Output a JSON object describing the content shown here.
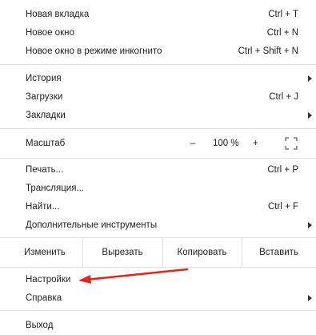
{
  "menu": {
    "new_tab": {
      "label": "Новая вкладка",
      "shortcut": "Ctrl + T"
    },
    "new_window": {
      "label": "Новое окно",
      "shortcut": "Ctrl + N"
    },
    "incognito": {
      "label": "Новое окно в режиме инкогнито",
      "shortcut": "Ctrl + Shift + N"
    },
    "history": {
      "label": "История"
    },
    "downloads": {
      "label": "Загрузки",
      "shortcut": "Ctrl + J"
    },
    "bookmarks": {
      "label": "Закладки"
    },
    "zoom": {
      "label": "Масштаб",
      "minus": "–",
      "value": "100 %",
      "plus": "+",
      "fullscreen_icon": "fullscreen-icon"
    },
    "print": {
      "label": "Печать...",
      "shortcut": "Ctrl + P"
    },
    "cast": {
      "label": "Трансляция..."
    },
    "find": {
      "label": "Найти...",
      "shortcut": "Ctrl + F"
    },
    "more_tools": {
      "label": "Дополнительные инструменты"
    },
    "edit": {
      "label": "Изменить",
      "cut": "Вырезать",
      "copy": "Копировать",
      "paste": "Вставить"
    },
    "settings": {
      "label": "Настройки"
    },
    "help": {
      "label": "Справка"
    },
    "exit": {
      "label": "Выход"
    }
  },
  "annotation": {
    "arrow_color": "#e0261d"
  }
}
